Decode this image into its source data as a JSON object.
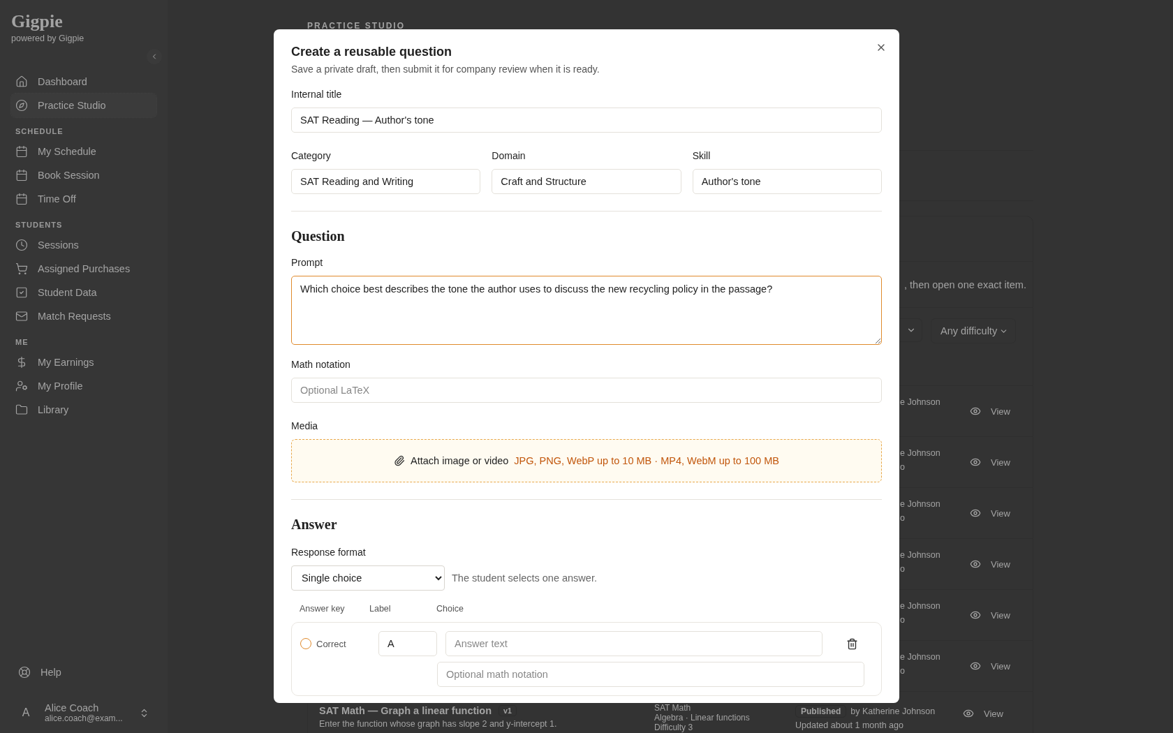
{
  "sidebar": {
    "brand": "Gigpie",
    "tagline": "powered by Gigpie",
    "sections": [
      {
        "items": [
          {
            "label": "Dashboard",
            "selected": false
          },
          {
            "label": "Practice Studio",
            "selected": true
          }
        ]
      },
      {
        "heading": "SCHEDULE",
        "items": [
          {
            "label": "My Schedule",
            "selected": false
          },
          {
            "label": "Book Session",
            "selected": false
          },
          {
            "label": "Time Off",
            "selected": false
          }
        ]
      },
      {
        "heading": "STUDENTS",
        "items": [
          {
            "label": "Sessions",
            "selected": false
          },
          {
            "label": "Assigned Purchases",
            "selected": false
          },
          {
            "label": "Student Data",
            "selected": false
          },
          {
            "label": "Match Requests",
            "selected": false
          }
        ]
      },
      {
        "heading": "ME",
        "items": [
          {
            "label": "My Earnings",
            "selected": false
          },
          {
            "label": "My Profile",
            "selected": false
          },
          {
            "label": "Library",
            "selected": false
          }
        ]
      }
    ],
    "help": "Help",
    "user": {
      "initial": "A",
      "name": "Alice Coach",
      "email": "alice.coach@exam..."
    }
  },
  "page": {
    "eyebrow": "PRACTICE STUDIO",
    "intro": ", then open one exact item.",
    "difficulty_filter": "Any difficulty",
    "rows": [
      {
        "author": "e Johnson",
        "action": "View"
      },
      {
        "author": "e Johnson",
        "updated": "o",
        "action": "View"
      },
      {
        "author": "e Johnson",
        "updated": "o",
        "action": "View"
      },
      {
        "author": "e Johnson",
        "updated": "o",
        "action": "View"
      },
      {
        "author": "e Johnson",
        "updated": "o",
        "action": "View"
      },
      {
        "author": "e Johnson",
        "updated": "o",
        "action": "View"
      }
    ],
    "last_row": {
      "title": "SAT Math — Graph a linear function",
      "version": "v1",
      "description": "Enter the function whose graph has slope 2 and y-intercept 1.",
      "category": "SAT Math",
      "topic": "Algebra · Linear functions",
      "difficulty": "Difficulty 3",
      "status": "Published",
      "author": "by Katherine Johnson",
      "updated": "Updated about 1 month ago",
      "action": "View"
    }
  },
  "dialog": {
    "title": "Create a reusable question",
    "subtitle": "Save a private draft, then submit it for company review when it is ready.",
    "internal_title": {
      "label": "Internal title",
      "value": "SAT Reading — Author's tone"
    },
    "taxonomy": [
      {
        "label": "Category",
        "value": "SAT Reading and Writing"
      },
      {
        "label": "Domain",
        "value": "Craft and Structure"
      },
      {
        "label": "Skill",
        "value": "Author's tone"
      }
    ],
    "question": {
      "heading": "Question",
      "prompt": {
        "label": "Prompt",
        "value": "Which choice best describes the tone the author uses to discuss the new recycling policy in the passage?",
        "focused": true
      },
      "math": {
        "label": "Math notation",
        "placeholder": "Optional LaTeX"
      },
      "media": {
        "label": "Media",
        "action": "Attach image or video",
        "formats": "JPG, PNG, WebP up to 10 MB · MP4, WebM up to 100 MB"
      }
    },
    "answer": {
      "heading": "Answer",
      "format_label": "Response format",
      "format": "Single choice",
      "format_hint": "The student selects one answer.",
      "columns": [
        "Answer key",
        "Label",
        "Choice"
      ],
      "choices": [
        {
          "correct": false,
          "correct_label": "Correct",
          "label": "A",
          "text_placeholder": "Answer text",
          "math_placeholder": "Optional math notation"
        }
      ]
    }
  }
}
